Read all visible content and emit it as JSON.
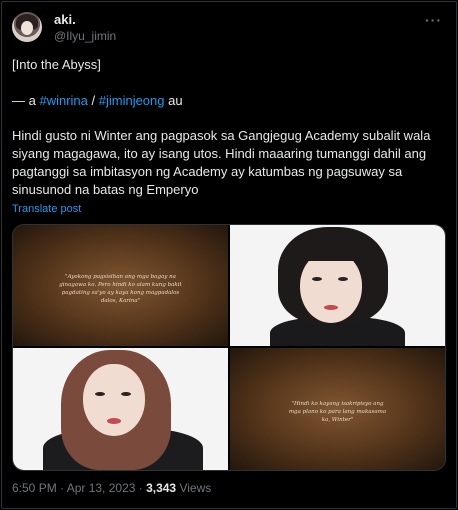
{
  "author": {
    "display_name": "aki.",
    "handle": "@Ilyu_jimin",
    "avatar_icon": "user-avatar"
  },
  "more_icon": "more-options-icon",
  "tweet": {
    "title_line": "[Into the Abyss]",
    "tags_prefix": "— a ",
    "tag1": "#winrina",
    "tag_sep": " / ",
    "tag2": "#jiminjeong",
    "tags_suffix": " au",
    "body": "Hindi gusto ni Winter ang pagpasok sa Gangjegug Academy subalit wala siyang magagawa, ito ay isang utos. Hindi maaaring tumanggi dahil ang pagtanggi sa imbitasyon ng Academy ay katumbas ng pagsuway sa sinusunod na batas ng Emperyo",
    "translate_label": "Translate post"
  },
  "media": {
    "quote1": "\"Ayokong pagsisihan ang mga bagay na ginagawa ko. Pero hindi ko alam kung bakit pagdating sa'yo ay kaya kong magpadalos dalos, Karina\"",
    "quote2": "\"Hindi ko kayang isakripisyo ang mga plano ko para lang makasama ka, Winter\""
  },
  "meta": {
    "time_date": "6:50 PM · Apr 13, 2023 · ",
    "views_count": "3,343",
    "views_label": " Views"
  },
  "colors": {
    "background": "#000000",
    "text": "#e7e9ea",
    "muted": "#71767b",
    "link": "#1d9bf0",
    "border": "#2f3336"
  }
}
